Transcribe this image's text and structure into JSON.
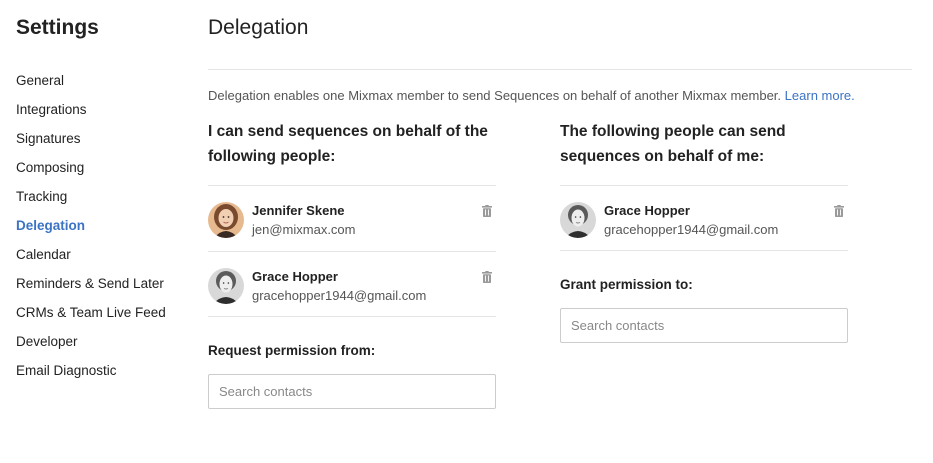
{
  "sidebar": {
    "title": "Settings",
    "items": [
      {
        "label": "General",
        "active": false
      },
      {
        "label": "Integrations",
        "active": false
      },
      {
        "label": "Signatures",
        "active": false
      },
      {
        "label": "Composing",
        "active": false
      },
      {
        "label": "Tracking",
        "active": false
      },
      {
        "label": "Delegation",
        "active": true
      },
      {
        "label": "Calendar",
        "active": false
      },
      {
        "label": "Reminders & Send Later",
        "active": false
      },
      {
        "label": "CRMs & Team Live Feed",
        "active": false
      },
      {
        "label": "Developer",
        "active": false
      },
      {
        "label": "Email Diagnostic",
        "active": false
      }
    ]
  },
  "main": {
    "title": "Delegation",
    "description": "Delegation enables one Mixmax member to send Sequences on behalf of another Mixmax member.",
    "learn_more": "Learn more.",
    "left": {
      "heading": "I can send sequences on behalf of the following people:",
      "people": [
        {
          "name": "Jennifer Skene",
          "email": "jen@mixmax.com",
          "icon": "trash-icon"
        },
        {
          "name": "Grace Hopper",
          "email": "gracehopper1944@gmail.com",
          "icon": "trash-icon"
        }
      ],
      "request_label": "Request permission from:",
      "search_placeholder": "Search contacts"
    },
    "right": {
      "heading": "The following people can send sequences on behalf of me:",
      "people": [
        {
          "name": "Grace Hopper",
          "email": "gracehopper1944@gmail.com",
          "icon": "trash-icon"
        }
      ],
      "grant_label": "Grant permission to:",
      "search_placeholder": "Search contacts"
    }
  },
  "colors": {
    "accent": "#3b73c5",
    "divider": "#e5e5e5",
    "trash": "#9a9a9a"
  }
}
